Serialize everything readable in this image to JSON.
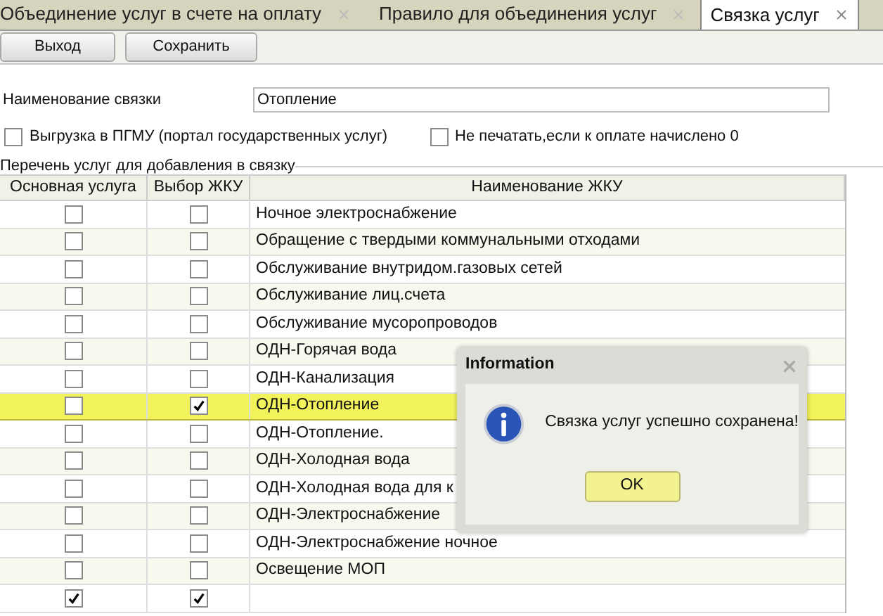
{
  "tabs": [
    {
      "label": "Объединение услуг в счете на оплату",
      "selected": false
    },
    {
      "label": "Правило для объединения услуг",
      "selected": false
    },
    {
      "label": "Связка услуг",
      "selected": true
    }
  ],
  "toolbar": {
    "buttons": [
      "Выход",
      "Сохранить"
    ]
  },
  "form": {
    "name_label": "Наименование связки",
    "name_value": "Отопление",
    "options": [
      {
        "label": "Выгрузка в ПГМУ (портал государственных услуг)",
        "checked": false
      },
      {
        "label": "Не печатать,если к оплате начислено 0",
        "checked": false
      }
    ]
  },
  "group_label": "Перечень услуг для добавления в связку",
  "table": {
    "columns": [
      "Основная услуга",
      "Выбор ЖКУ",
      "Наименование ЖКУ"
    ],
    "rows": [
      {
        "main": false,
        "pick": false,
        "name": "Ночное электроснабжение",
        "selected": false
      },
      {
        "main": false,
        "pick": false,
        "name": "Обращение с твердыми коммунальными отходами",
        "selected": false
      },
      {
        "main": false,
        "pick": false,
        "name": "Обслуживание внутридом.газовых сетей",
        "selected": false
      },
      {
        "main": false,
        "pick": false,
        "name": "Обслуживание лиц.счета",
        "selected": false
      },
      {
        "main": false,
        "pick": false,
        "name": "Обслуживание мусоропроводов",
        "selected": false
      },
      {
        "main": false,
        "pick": false,
        "name": "ОДН-Горячая вода",
        "selected": false
      },
      {
        "main": false,
        "pick": false,
        "name": "ОДН-Канализация",
        "selected": false
      },
      {
        "main": false,
        "pick": true,
        "name": "ОДН-Отопление",
        "selected": true
      },
      {
        "main": false,
        "pick": false,
        "name": "ОДН-Отопление.",
        "selected": false
      },
      {
        "main": false,
        "pick": false,
        "name": "ОДН-Холодная вода",
        "selected": false
      },
      {
        "main": false,
        "pick": false,
        "name": "ОДН-Холодная вода для к",
        "selected": false
      },
      {
        "main": false,
        "pick": false,
        "name": "ОДН-Электроснабжение",
        "selected": false
      },
      {
        "main": false,
        "pick": false,
        "name": "ОДН-Электроснабжение ночное",
        "selected": false
      },
      {
        "main": false,
        "pick": false,
        "name": "Освещение МОП",
        "selected": false
      },
      {
        "main": true,
        "pick": true,
        "selected": false
      }
    ]
  },
  "dialog": {
    "title": "Information",
    "message": "Связка услуг успешно сохранена!",
    "button": "OK"
  }
}
